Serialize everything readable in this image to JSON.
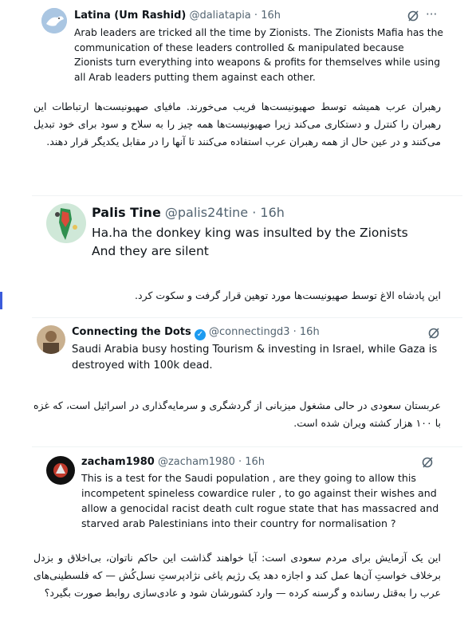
{
  "posts": [
    {
      "name": "Latina (Um Rashid)",
      "handle": "@daliatapia",
      "dot": "·",
      "time": "16h",
      "text": "Arab leaders are tricked all the time by Zionists. The Zionists Mafia has the\ncommunication of these leaders controlled & manipulated because\nZionists turn everything into weapons & profits for themselves while using\nall Arab leaders putting them against each other.",
      "more": "···",
      "translation": "رهبران عرب همیشه توسط صهیونیست‌ها فریب می‌خورند. مافیای صهیونیست‌ها ارتباطات این رهبران را کنترل و دستکاری می‌کند زیرا صهیونیست‌ها همه چیز را به سلاح و سود برای خود تبدیل می‌کنند و در عین حال از همه رهبران عرب استفاده می‌کنند تا آنها را در مقابل یکدیگر قرار دهند."
    },
    {
      "name": "Palis Tine",
      "handle": "@palis24tine",
      "dot": "·",
      "time": "16h",
      "text": "Ha.ha the donkey king was insulted by the Zionists\nAnd they are silent",
      "translation": "این پادشاه الاغ توسط صهیونیست‌ها مورد توهین قرار گرفت و سکوت کرد."
    },
    {
      "name": "Connecting the Dots",
      "verified": "✓",
      "handle": "@connectingd3",
      "dot": "·",
      "time": "16h",
      "text": "Saudi Arabia busy hosting Tourism & investing in Israel, while Gaza is\ndestroyed with 100k dead.",
      "translation": "عربستان سعودی در حالی مشغول میزبانی از گردشگری و سرمایه‌گذاری در اسرائیل است، که غزه با ۱۰۰ هزار کشته ویران شده است."
    },
    {
      "name": "zacham1980",
      "handle": "@zacham1980",
      "dot": "·",
      "time": "16h",
      "text": "This is a test for the Saudi population , are they going to allow this\nincompetent spineless cowardice ruler , to go against their wishes and\nallow a genocidal racist death cult rogue state that has  massacred and\nstarved arab Palestinians into their country for normalisation ?",
      "translation": "این یک آزمایش برای مردم سعودی است: آیا خواهند گذاشت این حاکم ناتوان، بی‌اخلاق و بزدل برخلاف خواستِ آن‌ها عمل کند و اجازه دهد یک رژیم یاغی نژادپرستِ نسل‌کُش — که فلسطینی‌های عرب را به‌قتل رسانده و گرسنه کرده — وارد کشورشان شود و عادی‌سازی روابط صورت بگیرد؟"
    }
  ],
  "icons": {
    "grok": "grok-icon",
    "more": "more-icon"
  },
  "colors": {
    "verified": "#1d9bf0",
    "secondary_text": "#536471",
    "accent_marker": "#3b5bdb"
  }
}
